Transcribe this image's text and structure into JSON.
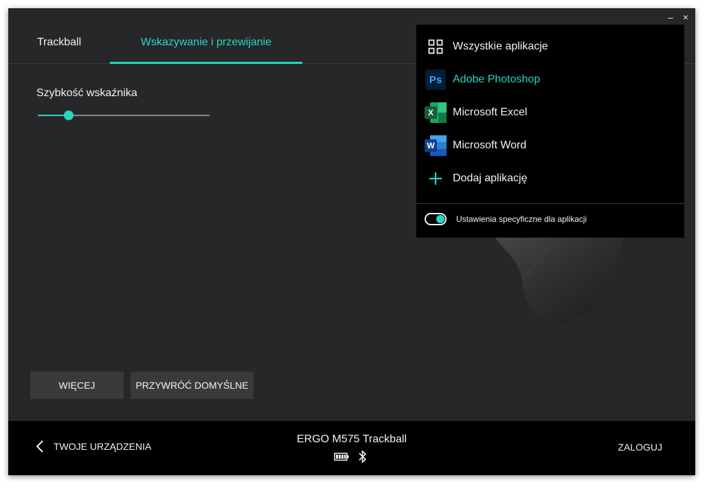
{
  "window": {
    "minimize_glyph": "–",
    "close_glyph": "×"
  },
  "tabs": [
    {
      "label": "Trackball",
      "active": false
    },
    {
      "label": "Wskazywanie i przewijanie",
      "active": true
    }
  ],
  "pointer_speed": {
    "label": "Szybkość wskaźnika",
    "value_fraction": 0.18
  },
  "buttons": {
    "more": "WIĘCEJ",
    "reset": "PRZYWRÓĆ DOMYŚLNE"
  },
  "footer": {
    "back_label": "TWOJE URZĄDZENIA",
    "device_name": "ERGO M575 Trackball",
    "login_label": "ZALOGUJ",
    "status_icons": [
      "battery-icon",
      "bluetooth-icon"
    ]
  },
  "app_menu": {
    "items": [
      {
        "label": "Wszystkie aplikacje",
        "icon": "grid-icon",
        "active": false
      },
      {
        "label": "Adobe Photoshop",
        "icon": "photoshop-icon",
        "icon_text": "Ps",
        "active": true
      },
      {
        "label": "Microsoft Excel",
        "icon": "excel-icon",
        "icon_text": "X",
        "active": false
      },
      {
        "label": "Microsoft Word",
        "icon": "word-icon",
        "icon_text": "W",
        "active": false
      },
      {
        "label": "Dodaj aplikację",
        "icon": "plus-icon",
        "active": false
      }
    ],
    "toggle_label": "Ustawienia specyficzne dla aplikacji",
    "toggle_on": true
  },
  "colors": {
    "accent": "#26d8c3",
    "window_bg": "#27272a",
    "menu_bg": "#000000",
    "button_bg": "#3a3a3d"
  }
}
